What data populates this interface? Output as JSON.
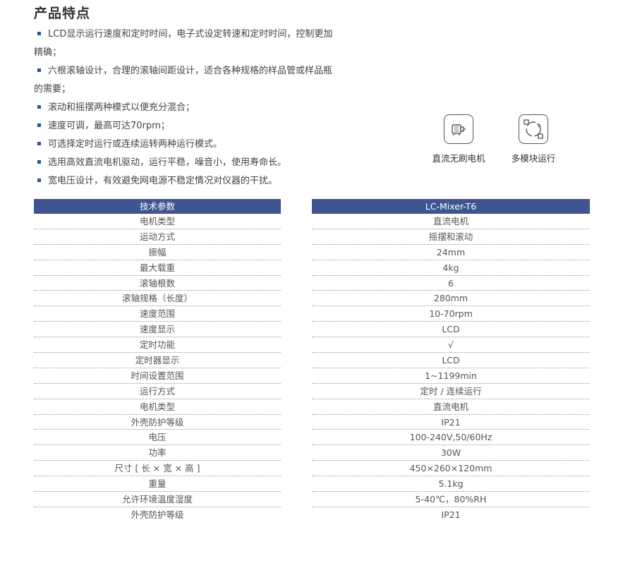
{
  "title": "产品特点",
  "features": [
    "LCD显示运行速度和定时时间，电子式设定转速和定时时间，控制更加精确；",
    "六根滚轴设计，合理的滚轴间距设计，适合各种规格的样品管或样品瓶的需要；",
    "滚动和摇摆两种模式以便充分混合；",
    "速度可调，最高可达70rpm；",
    "可选择定时运行或连续运转两种运行模式。",
    "选用高效直流电机驱动，运行平稳，噪音小，使用寿命长。",
    "宽电压设计，有效避免网电源不稳定情况对仪器的干扰。"
  ],
  "icons": {
    "motor": {
      "icon": "motor-icon",
      "label": "直流无刷电机"
    },
    "module": {
      "icon": "module-icon",
      "label": "多模块运行"
    }
  },
  "spec_table": {
    "param_header": "技术参数",
    "value_header": "LC-Mixer-T6",
    "header_color": "#3f5591",
    "params": [
      "电机类型",
      "运动方式",
      "振幅",
      "最大载重",
      "滚轴根数",
      "滚轴规格（长度）",
      "速度范围",
      "速度显示",
      "定时功能",
      "定时器显示",
      "时间设置范围",
      "运行方式",
      "电机类型",
      "外壳防护等级",
      "电压",
      "功率",
      "尺寸 [ 长 × 宽 × 高 ]",
      "重量",
      "允许环境温度湿度",
      "外壳防护等级"
    ],
    "values": [
      "直流电机",
      "摇摆和滚动",
      "24mm",
      "4kg",
      "6",
      "280mm",
      "10-70rpm",
      "LCD",
      "√",
      "LCD",
      "1~1199min",
      "定时 / 连续运行",
      "直流电机",
      "IP21",
      "100-240V,50/60Hz",
      "30W",
      "450×260×120mm",
      "5.1kg",
      "5-40℃，80%RH",
      "IP21"
    ]
  }
}
